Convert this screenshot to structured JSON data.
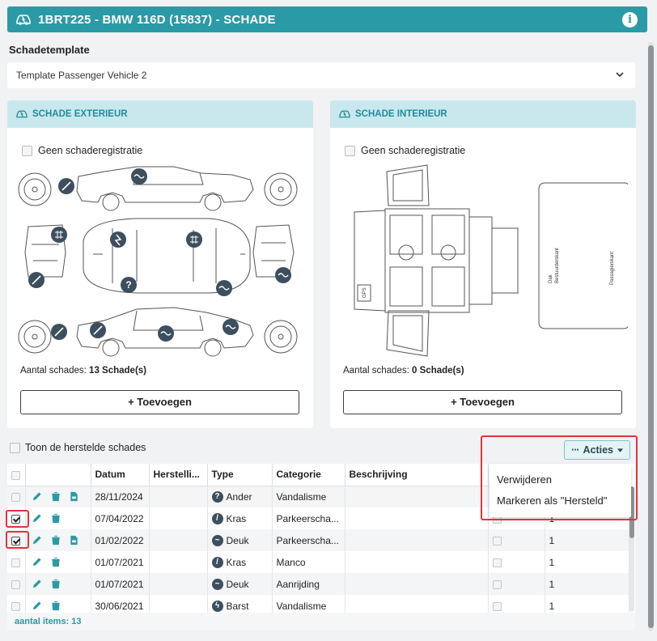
{
  "header": {
    "title": "1BRT225 - BMW 116D (15837) - SCHADE",
    "info_icon": "info-icon"
  },
  "template": {
    "label": "Schadetemplate",
    "value": "Template Passenger Vehicle 2"
  },
  "exterior": {
    "title": "SCHADE EXTERIEUR",
    "no_damage_label": "Geen schaderegistratie",
    "count_label": "Aantal schades:",
    "count_value": "13 Schade(s)",
    "add_button": "+ Toevoegen"
  },
  "interior": {
    "title": "SCHADE INTERIEUR",
    "no_damage_label": "Geen schaderegistratie",
    "count_label": "Aantal schades:",
    "count_value": "0 Schade(s)",
    "add_button": "+ Toevoegen",
    "diagram_labels": {
      "dak": "Dak",
      "bestuurder": "Bestuurderskant",
      "passagier": "Passagierskant",
      "gps": "GPS"
    }
  },
  "show_repaired_label": "Toon de herstelde schades",
  "actions": {
    "button_label": "Acties",
    "menu": [
      "Verwijderen",
      "Markeren als \"Hersteld\""
    ]
  },
  "table": {
    "columns": [
      "Datum",
      "Herstelli...",
      "Type",
      "Categorie",
      "Beschrijving"
    ],
    "rows": [
      {
        "checked": false,
        "pdf": true,
        "datum": "28/11/2024",
        "hersteld": "",
        "type": "Ander",
        "type_icon": "?",
        "categorie": "Vandalisme",
        "beschrijving": "",
        "extra": ""
      },
      {
        "checked": true,
        "pdf": false,
        "datum": "07/04/2022",
        "hersteld": "",
        "type": "Kras",
        "type_icon": "/",
        "categorie": "Parkeerscha...",
        "beschrijving": "",
        "extra": "1"
      },
      {
        "checked": true,
        "pdf": true,
        "datum": "01/02/2022",
        "hersteld": "",
        "type": "Deuk",
        "type_icon": "~",
        "categorie": "Parkeerscha...",
        "beschrijving": "",
        "extra": "1"
      },
      {
        "checked": false,
        "pdf": false,
        "datum": "01/07/2021",
        "hersteld": "",
        "type": "Kras",
        "type_icon": "/",
        "categorie": "Manco",
        "beschrijving": "",
        "extra": "1"
      },
      {
        "checked": false,
        "pdf": false,
        "datum": "01/07/2021",
        "hersteld": "",
        "type": "Deuk",
        "type_icon": "~",
        "categorie": "Aanrijding",
        "beschrijving": "",
        "extra": "1"
      },
      {
        "checked": false,
        "pdf": false,
        "datum": "30/06/2021",
        "hersteld": "",
        "type": "Barst",
        "type_icon": "ϟ",
        "categorie": "Vandalisme",
        "beschrijving": "",
        "extra": "1"
      }
    ]
  },
  "footer": {
    "items_label": "aantal items: 13"
  },
  "colors": {
    "accent": "#2a9aa6",
    "highlight": "#e0353d",
    "card_header": "#c9e8ee"
  }
}
